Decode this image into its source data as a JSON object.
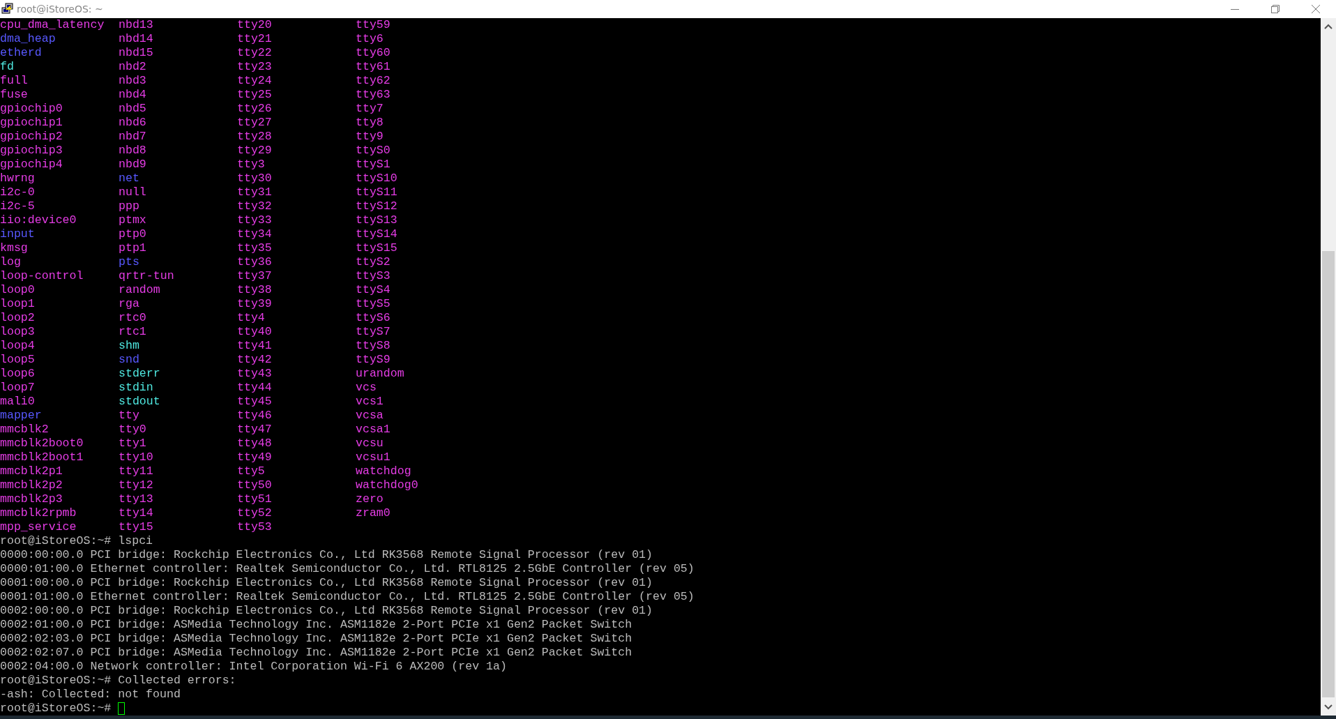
{
  "window": {
    "title": "root@iStoreOS: ~"
  },
  "listing": [
    [
      {
        "name": "cpu_dma_latency",
        "kind": "char"
      },
      {
        "name": "nbd13",
        "kind": "char"
      },
      {
        "name": "tty20",
        "kind": "char"
      },
      {
        "name": "tty59",
        "kind": "char"
      }
    ],
    [
      {
        "name": "dma_heap",
        "kind": "dir"
      },
      {
        "name": "nbd14",
        "kind": "char"
      },
      {
        "name": "tty21",
        "kind": "char"
      },
      {
        "name": "tty6",
        "kind": "char"
      }
    ],
    [
      {
        "name": "etherd",
        "kind": "dir"
      },
      {
        "name": "nbd15",
        "kind": "char"
      },
      {
        "name": "tty22",
        "kind": "char"
      },
      {
        "name": "tty60",
        "kind": "char"
      }
    ],
    [
      {
        "name": "fd",
        "kind": "link"
      },
      {
        "name": "nbd2",
        "kind": "char"
      },
      {
        "name": "tty23",
        "kind": "char"
      },
      {
        "name": "tty61",
        "kind": "char"
      }
    ],
    [
      {
        "name": "full",
        "kind": "char"
      },
      {
        "name": "nbd3",
        "kind": "char"
      },
      {
        "name": "tty24",
        "kind": "char"
      },
      {
        "name": "tty62",
        "kind": "char"
      }
    ],
    [
      {
        "name": "fuse",
        "kind": "char"
      },
      {
        "name": "nbd4",
        "kind": "char"
      },
      {
        "name": "tty25",
        "kind": "char"
      },
      {
        "name": "tty63",
        "kind": "char"
      }
    ],
    [
      {
        "name": "gpiochip0",
        "kind": "char"
      },
      {
        "name": "nbd5",
        "kind": "char"
      },
      {
        "name": "tty26",
        "kind": "char"
      },
      {
        "name": "tty7",
        "kind": "char"
      }
    ],
    [
      {
        "name": "gpiochip1",
        "kind": "char"
      },
      {
        "name": "nbd6",
        "kind": "char"
      },
      {
        "name": "tty27",
        "kind": "char"
      },
      {
        "name": "tty8",
        "kind": "char"
      }
    ],
    [
      {
        "name": "gpiochip2",
        "kind": "char"
      },
      {
        "name": "nbd7",
        "kind": "char"
      },
      {
        "name": "tty28",
        "kind": "char"
      },
      {
        "name": "tty9",
        "kind": "char"
      }
    ],
    [
      {
        "name": "gpiochip3",
        "kind": "char"
      },
      {
        "name": "nbd8",
        "kind": "char"
      },
      {
        "name": "tty29",
        "kind": "char"
      },
      {
        "name": "ttyS0",
        "kind": "char"
      }
    ],
    [
      {
        "name": "gpiochip4",
        "kind": "char"
      },
      {
        "name": "nbd9",
        "kind": "char"
      },
      {
        "name": "tty3",
        "kind": "char"
      },
      {
        "name": "ttyS1",
        "kind": "char"
      }
    ],
    [
      {
        "name": "hwrng",
        "kind": "char"
      },
      {
        "name": "net",
        "kind": "dir"
      },
      {
        "name": "tty30",
        "kind": "char"
      },
      {
        "name": "ttyS10",
        "kind": "char"
      }
    ],
    [
      {
        "name": "i2c-0",
        "kind": "char"
      },
      {
        "name": "null",
        "kind": "char"
      },
      {
        "name": "tty31",
        "kind": "char"
      },
      {
        "name": "ttyS11",
        "kind": "char"
      }
    ],
    [
      {
        "name": "i2c-5",
        "kind": "char"
      },
      {
        "name": "ppp",
        "kind": "char"
      },
      {
        "name": "tty32",
        "kind": "char"
      },
      {
        "name": "ttyS12",
        "kind": "char"
      }
    ],
    [
      {
        "name": "iio:device0",
        "kind": "char"
      },
      {
        "name": "ptmx",
        "kind": "char"
      },
      {
        "name": "tty33",
        "kind": "char"
      },
      {
        "name": "ttyS13",
        "kind": "char"
      }
    ],
    [
      {
        "name": "input",
        "kind": "dir"
      },
      {
        "name": "ptp0",
        "kind": "char"
      },
      {
        "name": "tty34",
        "kind": "char"
      },
      {
        "name": "ttyS14",
        "kind": "char"
      }
    ],
    [
      {
        "name": "kmsg",
        "kind": "char"
      },
      {
        "name": "ptp1",
        "kind": "char"
      },
      {
        "name": "tty35",
        "kind": "char"
      },
      {
        "name": "ttyS15",
        "kind": "char"
      }
    ],
    [
      {
        "name": "log",
        "kind": "char"
      },
      {
        "name": "pts",
        "kind": "dir"
      },
      {
        "name": "tty36",
        "kind": "char"
      },
      {
        "name": "ttyS2",
        "kind": "char"
      }
    ],
    [
      {
        "name": "loop-control",
        "kind": "char"
      },
      {
        "name": "qrtr-tun",
        "kind": "char"
      },
      {
        "name": "tty37",
        "kind": "char"
      },
      {
        "name": "ttyS3",
        "kind": "char"
      }
    ],
    [
      {
        "name": "loop0",
        "kind": "char"
      },
      {
        "name": "random",
        "kind": "char"
      },
      {
        "name": "tty38",
        "kind": "char"
      },
      {
        "name": "ttyS4",
        "kind": "char"
      }
    ],
    [
      {
        "name": "loop1",
        "kind": "char"
      },
      {
        "name": "rga",
        "kind": "char"
      },
      {
        "name": "tty39",
        "kind": "char"
      },
      {
        "name": "ttyS5",
        "kind": "char"
      }
    ],
    [
      {
        "name": "loop2",
        "kind": "char"
      },
      {
        "name": "rtc0",
        "kind": "char"
      },
      {
        "name": "tty4",
        "kind": "char"
      },
      {
        "name": "ttyS6",
        "kind": "char"
      }
    ],
    [
      {
        "name": "loop3",
        "kind": "char"
      },
      {
        "name": "rtc1",
        "kind": "char"
      },
      {
        "name": "tty40",
        "kind": "char"
      },
      {
        "name": "ttyS7",
        "kind": "char"
      }
    ],
    [
      {
        "name": "loop4",
        "kind": "char"
      },
      {
        "name": "shm",
        "kind": "link"
      },
      {
        "name": "tty41",
        "kind": "char"
      },
      {
        "name": "ttyS8",
        "kind": "char"
      }
    ],
    [
      {
        "name": "loop5",
        "kind": "char"
      },
      {
        "name": "snd",
        "kind": "dir"
      },
      {
        "name": "tty42",
        "kind": "char"
      },
      {
        "name": "ttyS9",
        "kind": "char"
      }
    ],
    [
      {
        "name": "loop6",
        "kind": "char"
      },
      {
        "name": "stderr",
        "kind": "link"
      },
      {
        "name": "tty43",
        "kind": "char"
      },
      {
        "name": "urandom",
        "kind": "char"
      }
    ],
    [
      {
        "name": "loop7",
        "kind": "char"
      },
      {
        "name": "stdin",
        "kind": "link"
      },
      {
        "name": "tty44",
        "kind": "char"
      },
      {
        "name": "vcs",
        "kind": "char"
      }
    ],
    [
      {
        "name": "mali0",
        "kind": "char"
      },
      {
        "name": "stdout",
        "kind": "link"
      },
      {
        "name": "tty45",
        "kind": "char"
      },
      {
        "name": "vcs1",
        "kind": "char"
      }
    ],
    [
      {
        "name": "mapper",
        "kind": "dir"
      },
      {
        "name": "tty",
        "kind": "char"
      },
      {
        "name": "tty46",
        "kind": "char"
      },
      {
        "name": "vcsa",
        "kind": "char"
      }
    ],
    [
      {
        "name": "mmcblk2",
        "kind": "char"
      },
      {
        "name": "tty0",
        "kind": "char"
      },
      {
        "name": "tty47",
        "kind": "char"
      },
      {
        "name": "vcsa1",
        "kind": "char"
      }
    ],
    [
      {
        "name": "mmcblk2boot0",
        "kind": "char"
      },
      {
        "name": "tty1",
        "kind": "char"
      },
      {
        "name": "tty48",
        "kind": "char"
      },
      {
        "name": "vcsu",
        "kind": "char"
      }
    ],
    [
      {
        "name": "mmcblk2boot1",
        "kind": "char"
      },
      {
        "name": "tty10",
        "kind": "char"
      },
      {
        "name": "tty49",
        "kind": "char"
      },
      {
        "name": "vcsu1",
        "kind": "char"
      }
    ],
    [
      {
        "name": "mmcblk2p1",
        "kind": "char"
      },
      {
        "name": "tty11",
        "kind": "char"
      },
      {
        "name": "tty5",
        "kind": "char"
      },
      {
        "name": "watchdog",
        "kind": "char"
      }
    ],
    [
      {
        "name": "mmcblk2p2",
        "kind": "char"
      },
      {
        "name": "tty12",
        "kind": "char"
      },
      {
        "name": "tty50",
        "kind": "char"
      },
      {
        "name": "watchdog0",
        "kind": "char"
      }
    ],
    [
      {
        "name": "mmcblk2p3",
        "kind": "char"
      },
      {
        "name": "tty13",
        "kind": "char"
      },
      {
        "name": "tty51",
        "kind": "char"
      },
      {
        "name": "zero",
        "kind": "char"
      }
    ],
    [
      {
        "name": "mmcblk2rpmb",
        "kind": "char"
      },
      {
        "name": "tty14",
        "kind": "char"
      },
      {
        "name": "tty52",
        "kind": "char"
      },
      {
        "name": "zram0",
        "kind": "char"
      }
    ],
    [
      {
        "name": "mpp_service",
        "kind": "char"
      },
      {
        "name": "tty15",
        "kind": "char"
      },
      {
        "name": "tty53",
        "kind": "char"
      }
    ]
  ],
  "output_lines": [
    "root@iStoreOS:~# lspci",
    "0000:00:00.0 PCI bridge: Rockchip Electronics Co., Ltd RK3568 Remote Signal Processor (rev 01)",
    "0000:01:00.0 Ethernet controller: Realtek Semiconductor Co., Ltd. RTL8125 2.5GbE Controller (rev 05)",
    "0001:00:00.0 PCI bridge: Rockchip Electronics Co., Ltd RK3568 Remote Signal Processor (rev 01)",
    "0001:01:00.0 Ethernet controller: Realtek Semiconductor Co., Ltd. RTL8125 2.5GbE Controller (rev 05)",
    "0002:00:00.0 PCI bridge: Rockchip Electronics Co., Ltd RK3568 Remote Signal Processor (rev 01)",
    "0002:01:00.0 PCI bridge: ASMedia Technology Inc. ASM1182e 2-Port PCIe x1 Gen2 Packet Switch",
    "0002:02:03.0 PCI bridge: ASMedia Technology Inc. ASM1182e 2-Port PCIe x1 Gen2 Packet Switch",
    "0002:02:07.0 PCI bridge: ASMedia Technology Inc. ASM1182e 2-Port PCIe x1 Gen2 Packet Switch",
    "0002:04:00.0 Network controller: Intel Corporation Wi-Fi 6 AX200 (rev 1a)",
    "root@iStoreOS:~# Collected errors:",
    "-ash: Collected: not found"
  ],
  "prompt": "root@iStoreOS:~#"
}
